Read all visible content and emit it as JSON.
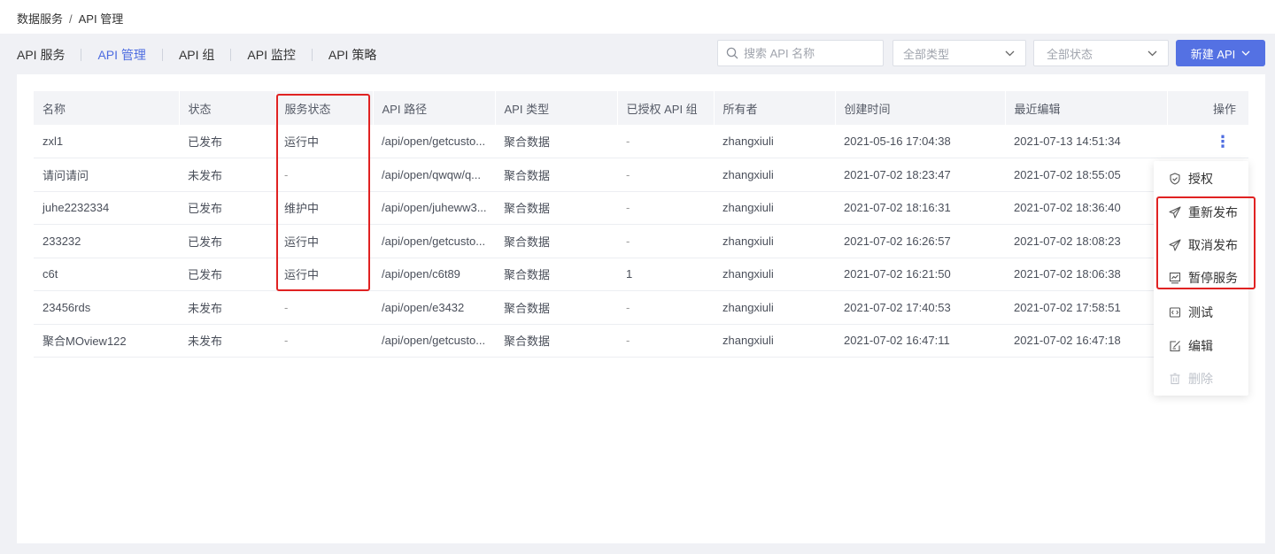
{
  "breadcrumb": {
    "parent": "数据服务",
    "separator": "/",
    "current": "API 管理"
  },
  "tabs": [
    {
      "label": "API 服务"
    },
    {
      "label": "API 管理"
    },
    {
      "label": "API 组"
    },
    {
      "label": "API 监控"
    },
    {
      "label": "API 策略"
    }
  ],
  "active_tab": "API 管理",
  "search": {
    "placeholder": "搜索 API 名称",
    "value": "",
    "icon": "search-icon"
  },
  "filters": {
    "type_selected": "全部类型",
    "status_selected": "全部状态"
  },
  "new_button": {
    "label": "新建 API"
  },
  "colors": {
    "accent": "#5471e3",
    "highlight": "#e02222",
    "header_bg": "#f3f4f7",
    "page_bg": "#f0f1f5"
  },
  "table": {
    "columns": [
      "名称",
      "状态",
      "服务状态",
      "API 路径",
      "API 类型",
      "已授权 API 组",
      "所有者",
      "创建时间",
      "最近编辑",
      "操作"
    ],
    "rows": [
      [
        "zxl1",
        "已发布",
        "运行中",
        "/api/open/getcusto...",
        "聚合数据",
        "-",
        "zhangxiuli",
        "2021-05-16 17:04:38",
        "2021-07-13 14:51:34"
      ],
      [
        "请问请问",
        "未发布",
        "-",
        "/api/open/qwqw/q...",
        "聚合数据",
        "-",
        "zhangxiuli",
        "2021-07-02 18:23:47",
        "2021-07-02 18:55:05"
      ],
      [
        "juhe2232334",
        "已发布",
        "维护中",
        "/api/open/juheww3...",
        "聚合数据",
        "-",
        "zhangxiuli",
        "2021-07-02 18:16:31",
        "2021-07-02 18:36:40"
      ],
      [
        "233232",
        "已发布",
        "运行中",
        "/api/open/getcusto...",
        "聚合数据",
        "-",
        "zhangxiuli",
        "2021-07-02 16:26:57",
        "2021-07-02 18:08:23"
      ],
      [
        "c6t",
        "已发布",
        "运行中",
        "/api/open/c6t89",
        "聚合数据",
        "1",
        "zhangxiuli",
        "2021-07-02 16:21:50",
        "2021-07-02 18:06:38"
      ],
      [
        "23456rds",
        "未发布",
        "-",
        "/api/open/e3432",
        "聚合数据",
        "-",
        "zhangxiuli",
        "2021-07-02 17:40:53",
        "2021-07-02 17:58:51"
      ],
      [
        "聚合MOview122",
        "未发布",
        "-",
        "/api/open/getcusto...",
        "聚合数据",
        "-",
        "zhangxiuli",
        "2021-07-02 16:47:11",
        "2021-07-02 16:47:18"
      ]
    ],
    "ops_icon": "more-vertical-icon"
  },
  "menu": [
    {
      "label": "授权",
      "icon": "shield-check-icon",
      "disabled": false
    },
    {
      "label": "重新发布",
      "icon": "send-icon",
      "disabled": false
    },
    {
      "label": "取消发布",
      "icon": "send-icon",
      "disabled": false
    },
    {
      "label": "暂停服务",
      "icon": "monitor-chart-icon",
      "disabled": false
    },
    {
      "label": "测试",
      "icon": "code-box-icon",
      "disabled": false
    },
    {
      "label": "编辑",
      "icon": "edit-icon",
      "disabled": false
    },
    {
      "label": "删除",
      "icon": "trash-icon",
      "disabled": true
    }
  ]
}
